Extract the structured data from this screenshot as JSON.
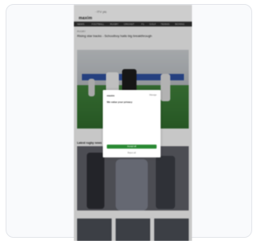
{
  "site": {
    "logo": "maxim",
    "tag": "· ITV plc"
  },
  "nav": [
    "NEWS",
    "FOOTBALL",
    "RUGBY",
    "CRICKET",
    "F1",
    "GOLF",
    "TENNIS",
    "BOXING"
  ],
  "article": {
    "section": "RUGBY",
    "headline": "Rising star backs - Schoolboy hails big breakthrough"
  },
  "caption": "",
  "related_label": "Latest rugby news",
  "modal": {
    "logo": "maxim",
    "link": "Manage",
    "title": "We value your privacy",
    "body": "",
    "list": "",
    "accept": "Accept all",
    "reject": "Reject all"
  },
  "thumbs": [
    {
      "caption": ""
    },
    {
      "caption": ""
    },
    {
      "caption": ""
    }
  ],
  "colors": {
    "accept_button": "#2a8a33",
    "nav_bg": "#2f2f2f",
    "banner": "#2e4f9c",
    "pitch": "#3f7f3a"
  }
}
